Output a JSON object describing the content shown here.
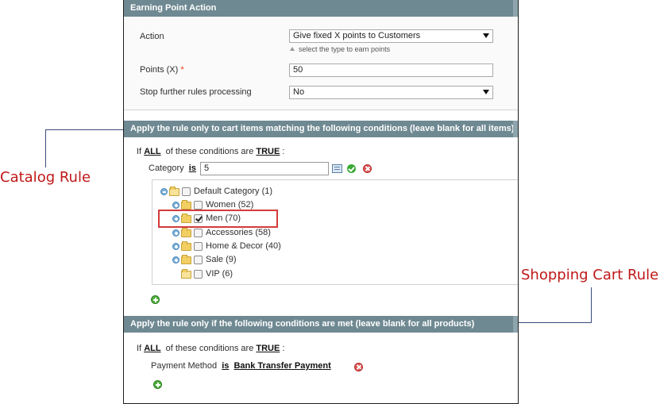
{
  "earning_section": {
    "title": "Earning Point Action",
    "action": {
      "label": "Action",
      "selected": "Give fixed X points to Customers",
      "note": "select the type to earn points"
    },
    "points": {
      "label": "Points (X)",
      "required_mark": "*",
      "value": "50"
    },
    "stop_processing": {
      "label": "Stop further rules processing",
      "selected": "No"
    }
  },
  "cart_items_section": {
    "title": "Apply the rule only to cart items matching the following conditions (leave blank for all items)",
    "condition": {
      "prefix": "If",
      "aggregator": "ALL",
      "middle": "of these conditions are",
      "value": "TRUE",
      "suffix": ":"
    },
    "category": {
      "label": "Category",
      "operator": "is",
      "value": "5"
    },
    "tree": [
      {
        "label": "Default Category (1)",
        "checked": false
      },
      {
        "label": "Women (52)",
        "checked": false
      },
      {
        "label": "Men (70)",
        "checked": true
      },
      {
        "label": "Accessories (58)",
        "checked": false
      },
      {
        "label": "Home & Decor (40)",
        "checked": false
      },
      {
        "label": "Sale (9)",
        "checked": false
      },
      {
        "label": "VIP (6)",
        "checked": false
      }
    ]
  },
  "conditions_section": {
    "title": "Apply the rule only if the following conditions are met (leave blank for all products)",
    "condition": {
      "prefix": "If",
      "aggregator": "ALL",
      "middle": "of these conditions are",
      "value": "TRUE",
      "suffix": ":"
    },
    "payment": {
      "label": "Payment Method",
      "operator": "is",
      "value": "Bank Transfer Payment"
    }
  },
  "annotations": {
    "catalog_rule": "Catalog Rule",
    "shopping_cart_rule": "Shopping Cart Rule",
    "color": "#c01818"
  },
  "colors": {
    "section_header": "#6f8992",
    "highlight": "#d33b3b"
  },
  "icons": [
    "chooser-icon",
    "apply-icon",
    "remove-icon",
    "add-condition-icon",
    "tree-toggle-icon",
    "folder-icon",
    "checkbox-icon",
    "dropdown-arrow-icon"
  ]
}
